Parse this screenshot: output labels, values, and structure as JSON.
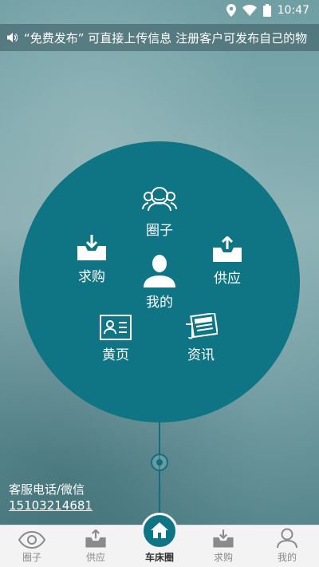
{
  "status": {
    "time": "10:47"
  },
  "marquee": {
    "text": "“免费发布” 可直接上传信息   注册客户可发布自己的物"
  },
  "menu": {
    "circle": "圈子",
    "purchase": "求购",
    "supply": "供应",
    "mine": "我的",
    "yellow_pages": "黄页",
    "news": "资讯"
  },
  "contact": {
    "label": "客服电话/微信",
    "phone": "15103214681"
  },
  "nav": {
    "items": [
      {
        "label": "圈子",
        "icon": "eye-icon"
      },
      {
        "label": "供应",
        "icon": "upload-tray-icon"
      },
      {
        "label": "车床圈",
        "icon": "home-icon"
      },
      {
        "label": "求购",
        "icon": "download-tray-icon"
      },
      {
        "label": "我的",
        "icon": "person-icon"
      }
    ]
  },
  "colors": {
    "accent": "#0f7484",
    "nav_bg": "#f3f3f3",
    "nav_text": "#8a8a8a"
  }
}
